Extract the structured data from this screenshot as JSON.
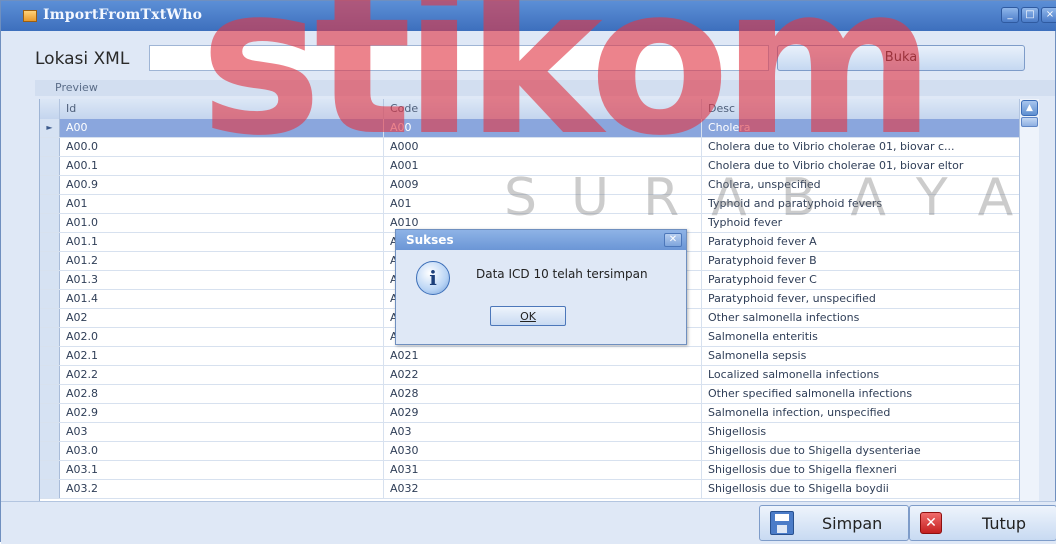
{
  "window": {
    "title": "ImportFromTxtWho",
    "controls": [
      "_",
      "□",
      "×"
    ]
  },
  "watermark": {
    "main": "stikom",
    "sub": "SURABAYA"
  },
  "location": {
    "label": "Lokasi XML",
    "value": "",
    "browse_label": "Buka"
  },
  "preview": {
    "label": "Preview",
    "columns": [
      "Id",
      "Code",
      "Desc"
    ],
    "selected_row_marker": "►",
    "rows": [
      [
        "A00",
        "A00",
        "Cholera"
      ],
      [
        "A00.0",
        "A000",
        "Cholera due to Vibrio cholerae 01, biovar c..."
      ],
      [
        "A00.1",
        "A001",
        "Cholera due to Vibrio cholerae 01, biovar eltor"
      ],
      [
        "A00.9",
        "A009",
        "Cholera, unspecified"
      ],
      [
        "A01",
        "A01",
        "Typhoid and paratyphoid fevers"
      ],
      [
        "A01.0",
        "A010",
        "Typhoid fever"
      ],
      [
        "A01.1",
        "A011",
        "Paratyphoid fever A"
      ],
      [
        "A01.2",
        "A012",
        "Paratyphoid fever B"
      ],
      [
        "A01.3",
        "A013",
        "Paratyphoid fever C"
      ],
      [
        "A01.4",
        "A014",
        "Paratyphoid fever, unspecified"
      ],
      [
        "A02",
        "A02",
        "Other salmonella infections"
      ],
      [
        "A02.0",
        "A020",
        "Salmonella enteritis"
      ],
      [
        "A02.1",
        "A021",
        "Salmonella sepsis"
      ],
      [
        "A02.2",
        "A022",
        "Localized salmonella infections"
      ],
      [
        "A02.8",
        "A028",
        "Other specified salmonella infections"
      ],
      [
        "A02.9",
        "A029",
        "Salmonella infection, unspecified"
      ],
      [
        "A03",
        "A03",
        "Shigellosis"
      ],
      [
        "A03.0",
        "A030",
        "Shigellosis due to Shigella dysenteriae"
      ],
      [
        "A03.1",
        "A031",
        "Shigellosis due to Shigella flexneri"
      ],
      [
        "A03.2",
        "A032",
        "Shigellosis due to Shigella boydii"
      ]
    ]
  },
  "dialog": {
    "title": "Sukses",
    "message": "Data ICD 10 telah tersimpan",
    "ok_label": "OK",
    "icon": "info-icon"
  },
  "footer": {
    "save_label": "Simpan",
    "close_label": "Tutup"
  }
}
